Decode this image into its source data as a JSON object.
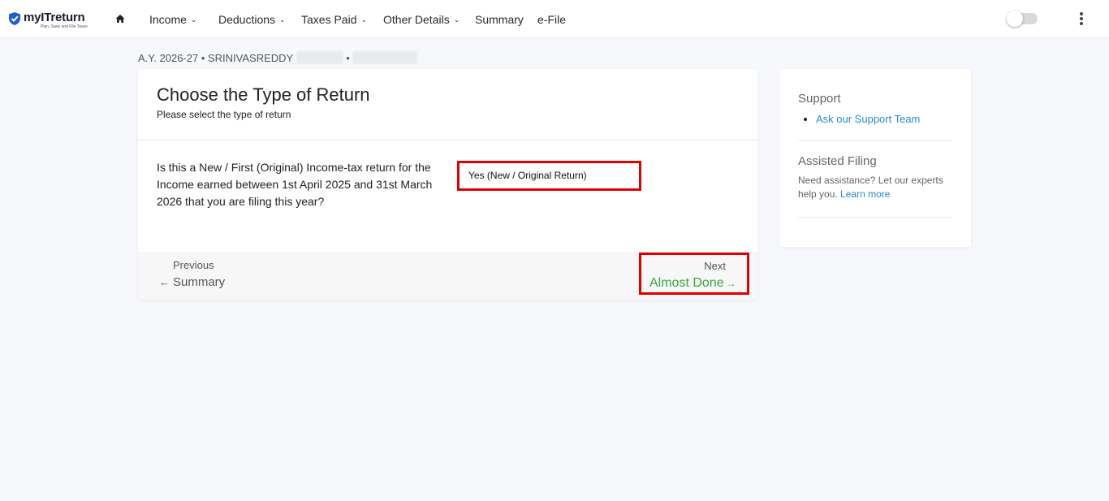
{
  "header": {
    "brand": "myITreturn",
    "tagline": "Plan, Save and File Taxes",
    "nav": [
      {
        "label": "Income",
        "dropdown": true
      },
      {
        "label": "Deductions",
        "dropdown": true
      },
      {
        "label": "Taxes Paid",
        "dropdown": true
      },
      {
        "label": "Other Details",
        "dropdown": true
      },
      {
        "label": "Summary",
        "dropdown": false
      },
      {
        "label": "e-File",
        "dropdown": false
      }
    ],
    "theme_toggle_on": false
  },
  "breadcrumb": {
    "text": "A.Y. 2026-27 • SRINIVASREDDY",
    "separator": "•"
  },
  "main": {
    "title": "Choose the Type of Return",
    "subtitle": "Please select the type of return",
    "question": "Is this a New / First (Original) Income-tax return for the Income earned between 1st April 2025 and 31st March 2026 that you are filing this year?",
    "return_type_value": "Yes (New / Original Return)",
    "previous_label": "Previous",
    "previous_target": "Summary",
    "next_label": "Next",
    "next_target": "Almost Done"
  },
  "sidebar": {
    "support_heading": "Support",
    "support_link": "Ask our Support Team",
    "assisted_heading": "Assisted Filing",
    "assisted_text": "Need assistance? Let our experts help you.",
    "assisted_link": "Learn more"
  },
  "colors": {
    "accent_green": "#3aa53f",
    "link_blue": "#2a8ad6",
    "highlight_red": "#e00000",
    "page_bg": "#f6f8fc"
  },
  "icons": [
    "shield-check-icon",
    "home-icon",
    "chevron-down-icon",
    "toggle-switch",
    "kebab-menu-icon",
    "arrow-left-icon",
    "arrow-right-icon"
  ]
}
